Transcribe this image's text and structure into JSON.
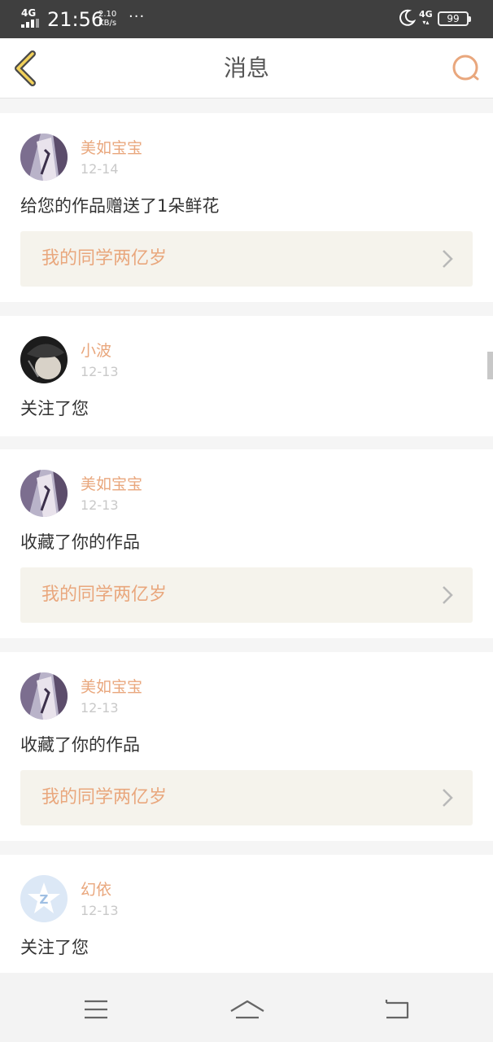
{
  "status_bar": {
    "network": "4G",
    "time": "21:56",
    "speed_value": "2.10",
    "speed_unit": "KB/s",
    "more": "···",
    "network_right": "4G",
    "battery": "99"
  },
  "header": {
    "title": "消息",
    "back_icon": "back-chevron-icon",
    "search_icon": "search-icon",
    "accent_color": "#e9a77d"
  },
  "messages": [
    {
      "user": "美如宝宝",
      "date": "12-14",
      "action": "给您的作品赠送了1朵鲜花",
      "work": "我的同学两亿岁"
    },
    {
      "user": "小波",
      "date": "12-13",
      "action": "关注了您",
      "work": ""
    },
    {
      "user": "美如宝宝",
      "date": "12-13",
      "action": "收藏了你的作品",
      "work": "我的同学两亿岁"
    },
    {
      "user": "美如宝宝",
      "date": "12-13",
      "action": "收藏了你的作品",
      "work": "我的同学两亿岁"
    },
    {
      "user": "幻依",
      "date": "12-13",
      "action": "关注了您",
      "work": ""
    }
  ],
  "nav_bar": {
    "menu_icon": "menu-icon",
    "home_icon": "home-icon",
    "back_icon": "return-icon"
  }
}
